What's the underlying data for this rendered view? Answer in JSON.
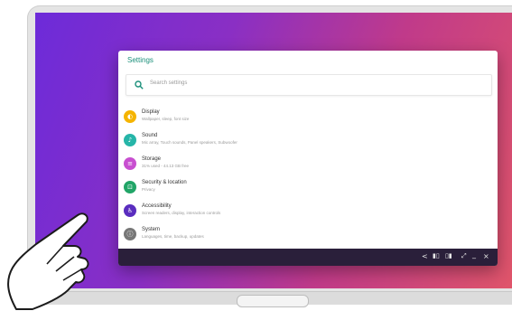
{
  "window": {
    "title": "Settings"
  },
  "search": {
    "placeholder": "Search settings"
  },
  "items": [
    {
      "title": "Display",
      "subtitle": "Wallpaper, sleep, font size",
      "icon": "display-icon",
      "color": "#f5b400"
    },
    {
      "title": "Sound",
      "subtitle": "Mic array, Touch sounds, Panel speakers, Subwoofer",
      "icon": "sound-icon",
      "color": "#26b5a8"
    },
    {
      "title": "Storage",
      "subtitle": "31% used - 44.13 GB free",
      "icon": "storage-icon",
      "color": "#c84fd0"
    },
    {
      "title": "Security & location",
      "subtitle": "Privacy",
      "icon": "lock-icon",
      "color": "#21a567"
    },
    {
      "title": "Accessibility",
      "subtitle": "Screen readers, display, interaction controls",
      "icon": "accessibility-icon",
      "color": "#5a2dbf"
    },
    {
      "title": "System",
      "subtitle": "Languages, time, backup, updates",
      "icon": "info-icon",
      "color": "#777777"
    }
  ],
  "taskbar": {
    "back": "<",
    "minimize": "_",
    "close": "×"
  },
  "colors": {
    "accent": "#1a8f7a",
    "taskbar": "#2a1f3a"
  }
}
